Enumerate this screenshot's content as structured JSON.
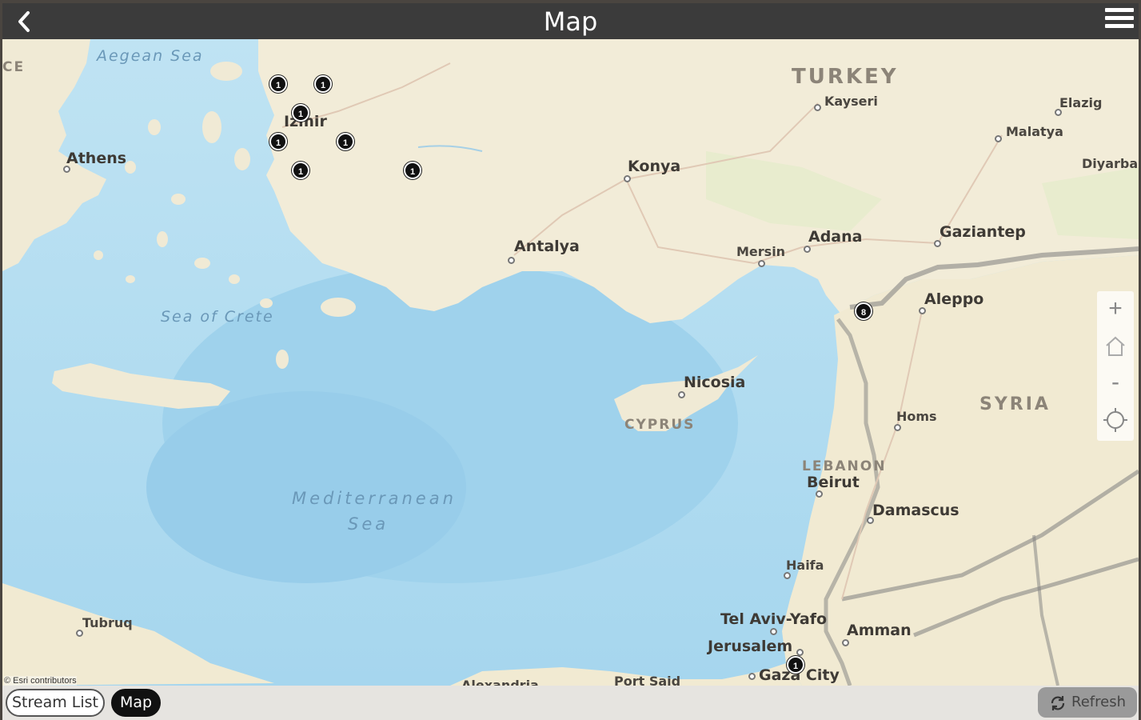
{
  "header": {
    "title": "Map",
    "back_icon": "chevron-left-icon",
    "menu_icon": "hamburger-menu-icon"
  },
  "map": {
    "labels": {
      "aegean_sea": "Aegean Sea",
      "ce_fragment": "CE",
      "turkey": "TURKEY",
      "kayseri": "Kayseri",
      "elazig": "Elazig",
      "malatya": "Malatya",
      "diyarba": "Diyarba",
      "izmir": "Izmir",
      "athens": "Athens",
      "konya": "Konya",
      "antalya": "Antalya",
      "mersin": "Mersin",
      "adana": "Adana",
      "gaziantep": "Gaziantep",
      "aleppo": "Aleppo",
      "sea_of_crete": "Sea of Crete",
      "nicosia": "Nicosia",
      "cyprus": "CYPRUS",
      "syria": "SYRIA",
      "homs": "Homs",
      "lebanon": "LEBANON",
      "beirut": "Beirut",
      "damascus": "Damascus",
      "mediterranean_1": "Mediterranean",
      "mediterranean_2": "Sea",
      "haifa": "Haifa",
      "tel_aviv": "Tel Aviv-Yafo",
      "amman": "Amman",
      "jerusalem": "Jerusalem",
      "tubruq": "Tubruq",
      "gaza": "Gaza City",
      "port_said": "Port Said",
      "alexandria": "Alexandria"
    },
    "attribution": "© Esri contributors",
    "markers": [
      "1",
      "1",
      "1",
      "1",
      "1",
      "1",
      "1",
      "8",
      "1"
    ],
    "controls": {
      "zoom_in": "+",
      "home_icon": "home-icon",
      "zoom_out": "-",
      "locate_icon": "locate-crosshair-icon"
    },
    "colors": {
      "water": "#a9d8ee",
      "land": "#f2ecd8",
      "border": "#8a8a8a"
    }
  },
  "footer": {
    "stream_list": "Stream List",
    "map": "Map",
    "refresh": "Refresh",
    "refresh_icon": "refresh-icon"
  }
}
